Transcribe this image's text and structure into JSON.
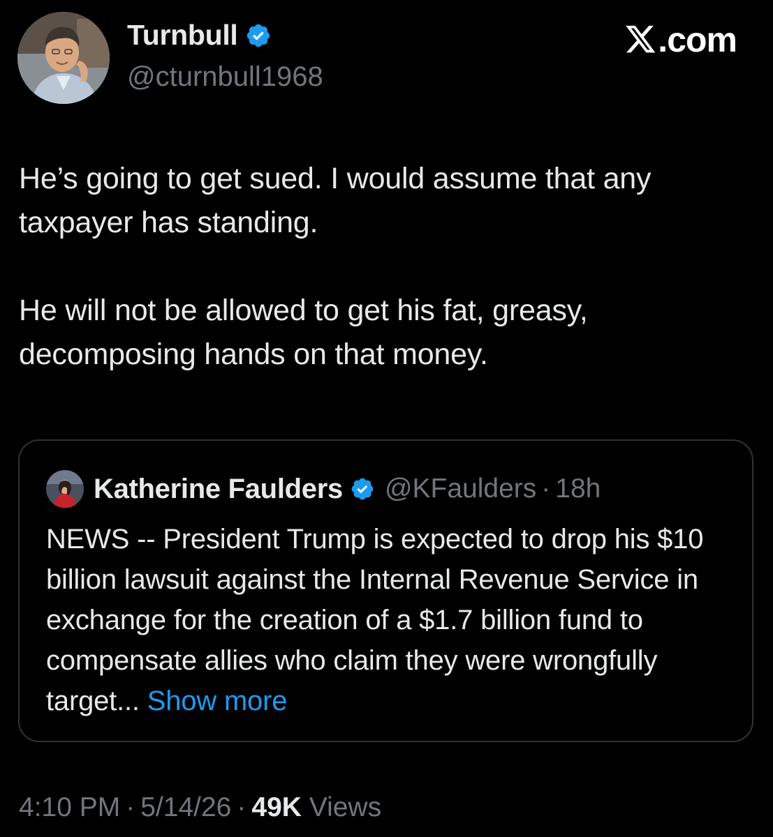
{
  "author": {
    "display_name": "Turnbull",
    "handle": "@cturnbull1968",
    "verified_icon": "verified-badge-icon",
    "avatar_icon": "avatar-illustration"
  },
  "brand": {
    "logo_icon": "x-logo-icon",
    "suffix": ".com"
  },
  "tweet": {
    "paragraphs": [
      "He’s going to get sued. I would assume that any taxpayer has standing.",
      "He will not be allowed to get his fat, greasy, decomposing hands on that money."
    ]
  },
  "quote": {
    "display_name": "Katherine Faulders",
    "handle": "@KFaulders",
    "separator": "·",
    "time": "18h",
    "text": "NEWS -- President Trump is expected to drop his $10 billion lawsuit against the Internal Revenue Service in exchange for the creation of a $1.7 billion fund to compensate allies who claim they were wrongfully target",
    "ellipsis": "...",
    "show_more": "Show more"
  },
  "meta": {
    "time": "4:10 PM",
    "separator": "·",
    "date": "5/14/26",
    "views_count": "49K",
    "views_label": "Views"
  },
  "colors": {
    "background": "#000000",
    "text_primary": "#e7e9ea",
    "text_secondary": "#71767b",
    "accent": "#1d9bf0",
    "border": "#2f3336"
  }
}
